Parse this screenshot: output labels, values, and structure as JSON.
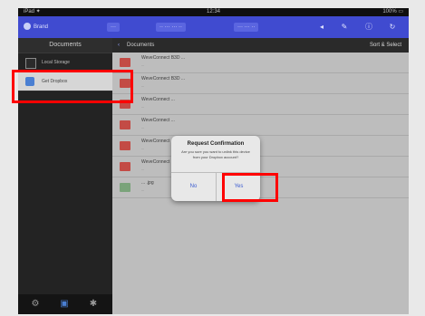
{
  "status_bar": {
    "carrier": "iPad ✦",
    "time": "12:34",
    "battery": "100% ▭"
  },
  "top_bar": {
    "brand": "Brand",
    "segments": [
      "···",
      "·· ··· ··· ··",
      "··· ··· ··"
    ]
  },
  "sidebar": {
    "header": "Documents",
    "items": [
      {
        "label": "Local Storage",
        "selected": false
      },
      {
        "label": "Get Dropbox",
        "selected": true
      }
    ],
    "bottom_icons": [
      "settings-icon",
      "folder-icon",
      "gear-icon"
    ]
  },
  "main": {
    "breadcrumb_back": "‹",
    "breadcrumb": "Documents",
    "header_right": "Sort & Select",
    "files": [
      {
        "name": "WeveConnect B3D ...",
        "meta": "..."
      },
      {
        "name": "WeveConnect B3D ...",
        "meta": "..."
      },
      {
        "name": "WeveConnect ...",
        "meta": "..."
      },
      {
        "name": "WeveConnect ...",
        "meta": "..."
      },
      {
        "name": "WeveConnect ...",
        "meta": "..."
      },
      {
        "name": "WeveConnect ...",
        "meta": "..."
      },
      {
        "name": "... .jpg",
        "meta": "..."
      }
    ]
  },
  "dialog": {
    "title": "Request Confirmation",
    "message": "Are you sure you want to unlink this device from your Dropbox account?",
    "no_label": "No",
    "yes_label": "Yes"
  },
  "colors": {
    "accent": "#404bd0",
    "highlight": "#ff0000",
    "selected_bg": "#d6d6d6",
    "file_icon": "#c34b45"
  }
}
